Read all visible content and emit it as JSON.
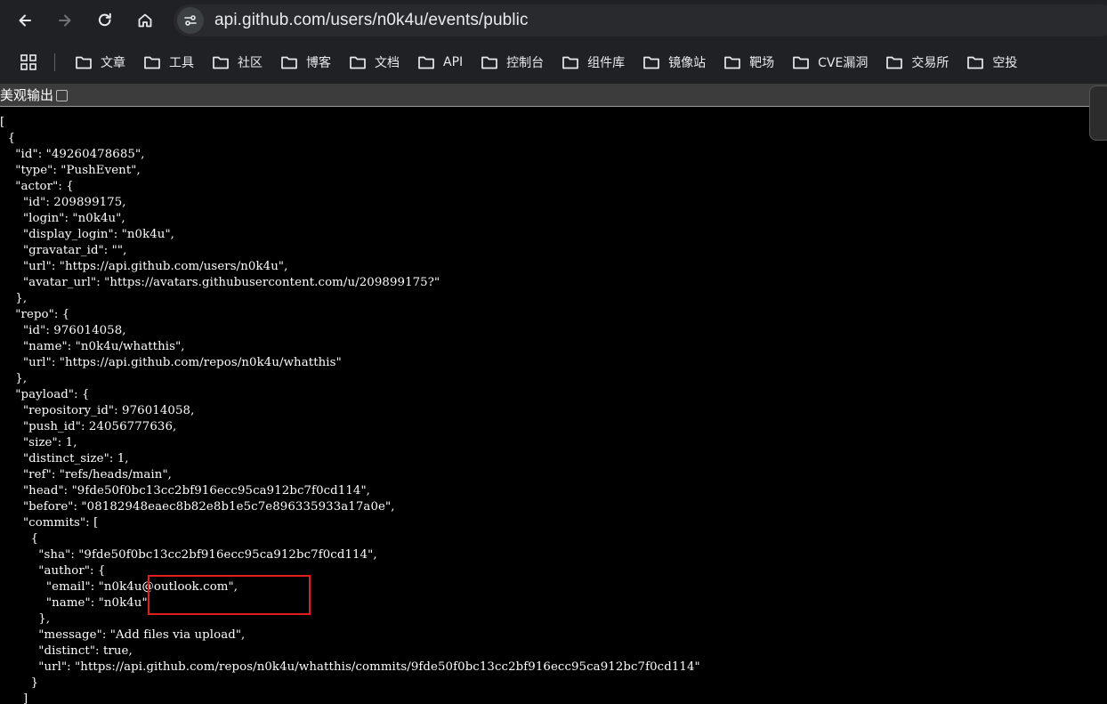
{
  "browser": {
    "url": "api.github.com/users/n0k4u/events/public",
    "nav_icons": [
      "back-arrow-icon",
      "forward-arrow-icon",
      "reload-icon",
      "home-icon",
      "tune-icon"
    ]
  },
  "bookmarks": [
    {
      "label": "文章"
    },
    {
      "label": "工具"
    },
    {
      "label": "社区"
    },
    {
      "label": "博客"
    },
    {
      "label": "文档"
    },
    {
      "label": "API"
    },
    {
      "label": "控制台"
    },
    {
      "label": "组件库"
    },
    {
      "label": "镜像站"
    },
    {
      "label": "靶场"
    },
    {
      "label": "CVE漏洞"
    },
    {
      "label": "交易所"
    },
    {
      "label": "空投"
    }
  ],
  "viewer": {
    "pretty_print_label": "美观输出",
    "pretty_print_checked": false
  },
  "json_lines": [
    "[",
    "  {",
    "    \"id\": \"49260478685\",",
    "    \"type\": \"PushEvent\",",
    "    \"actor\": {",
    "      \"id\": 209899175,",
    "      \"login\": \"n0k4u\",",
    "      \"display_login\": \"n0k4u\",",
    "      \"gravatar_id\": \"\",",
    "      \"url\": \"https://api.github.com/users/n0k4u\",",
    "      \"avatar_url\": \"https://avatars.githubusercontent.com/u/209899175?\"",
    "    },",
    "    \"repo\": {",
    "      \"id\": 976014058,",
    "      \"name\": \"n0k4u/whatthis\",",
    "      \"url\": \"https://api.github.com/repos/n0k4u/whatthis\"",
    "    },",
    "    \"payload\": {",
    "      \"repository_id\": 976014058,",
    "      \"push_id\": 24056777636,",
    "      \"size\": 1,",
    "      \"distinct_size\": 1,",
    "      \"ref\": \"refs/heads/main\",",
    "      \"head\": \"9fde50f0bc13cc2bf916ecc95ca912bc7f0cd114\",",
    "      \"before\": \"08182948eaec8b82e8b1e5c7e896335933a17a0e\",",
    "      \"commits\": [",
    "        {",
    "          \"sha\": \"9fde50f0bc13cc2bf916ecc95ca912bc7f0cd114\",",
    "          \"author\": {",
    "            \"email\": \"n0k4u@outlook.com\",",
    "            \"name\": \"n0k4u\"",
    "          },",
    "          \"message\": \"Add files via upload\",",
    "          \"distinct\": true,",
    "          \"url\": \"https://api.github.com/repos/n0k4u/whatthis/commits/9fde50f0bc13cc2bf916ecc95ca912bc7f0cd114\"",
    "        }",
    "      ]"
  ],
  "highlight": {
    "color": "#e11d1d"
  }
}
